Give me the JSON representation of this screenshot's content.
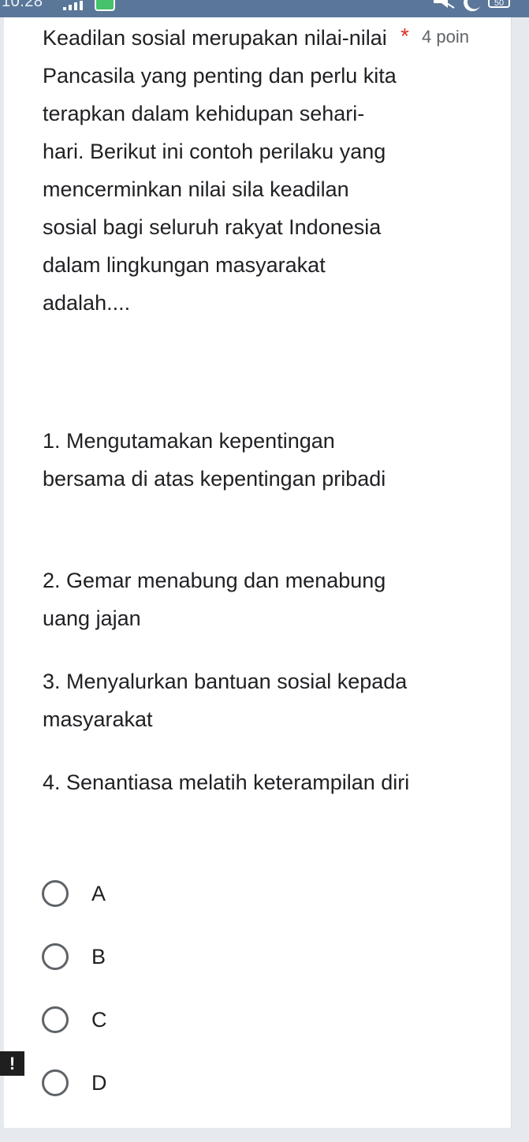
{
  "status_bar": {
    "time": "10.28",
    "battery": "50"
  },
  "question": {
    "text": "Keadilan sosial merupakan nilai-nilai Pancasila yang penting dan perlu kita terapkan dalam kehidupan sehari-hari. Berikut ini contoh perilaku yang mencerminkan nilai sila keadilan sosial bagi seluruh rakyat Indonesia dalam lingkungan masyarakat adalah....",
    "required_mark": "*",
    "points": "4 poin",
    "items": [
      "1. Mengutamakan kepentingan bersama di atas kepentingan pribadi",
      "2. Gemar menabung dan menabung uang jajan",
      "3. Menyalurkan bantuan sosial kepada masyarakat",
      "4. Senantiasa melatih keterampilan diri"
    ]
  },
  "options": [
    "A",
    "B",
    "C",
    "D"
  ],
  "alert": "!"
}
